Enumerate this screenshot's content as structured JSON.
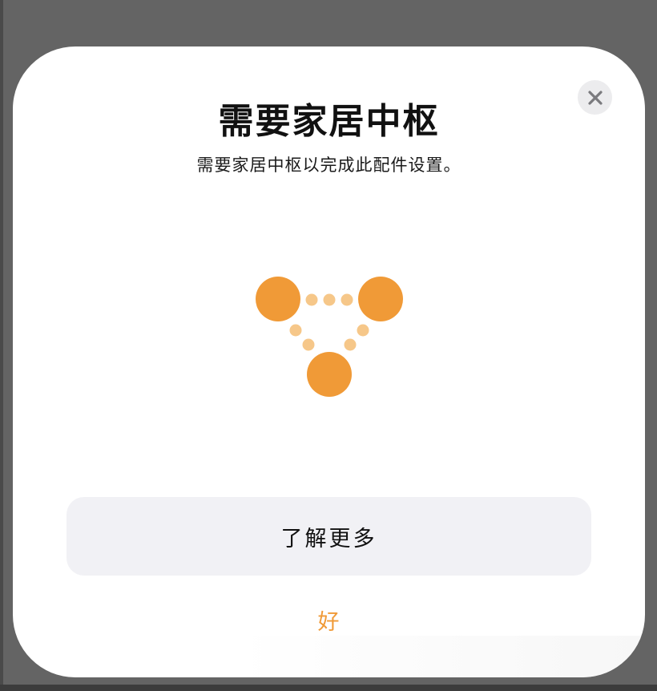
{
  "dialog": {
    "title": "需要家居中枢",
    "subtitle": "需要家居中枢以完成此配件设置。",
    "close_icon": "close-icon",
    "graphic_icon": "home-hub-network-icon",
    "accent_color": "#f09a37",
    "learn_more_label": "了解更多",
    "ok_label": "好"
  }
}
